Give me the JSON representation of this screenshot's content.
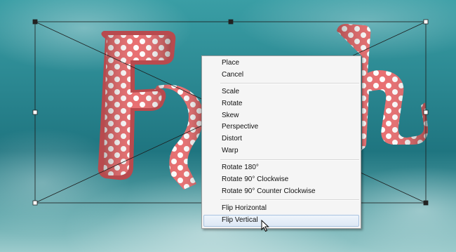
{
  "context_menu": {
    "groups": [
      [
        {
          "label": "Place"
        },
        {
          "label": "Cancel"
        }
      ],
      [
        {
          "label": "Scale"
        },
        {
          "label": "Rotate"
        },
        {
          "label": "Skew"
        },
        {
          "label": "Perspective"
        },
        {
          "label": "Distort"
        },
        {
          "label": "Warp"
        }
      ],
      [
        {
          "label": "Rotate 180°"
        },
        {
          "label": "Rotate 90° Clockwise"
        },
        {
          "label": "Rotate 90° Counter Clockwise"
        }
      ],
      [
        {
          "label": "Flip Horizontal"
        },
        {
          "label": "Flip Vertical"
        }
      ]
    ],
    "hovered_item": "Flip Vertical"
  },
  "colors": {
    "letter_pink": "#e8686a",
    "dot_white": "#ffffff",
    "menu_bg": "#f5f5f5"
  },
  "icons": [
    "transform-handle",
    "mouse-pointer-icon"
  ]
}
